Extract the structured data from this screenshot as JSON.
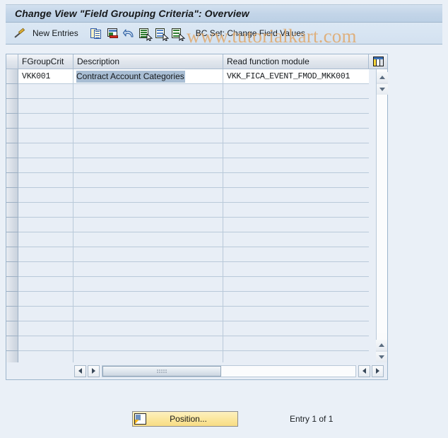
{
  "window": {
    "title": "Change View \"Field Grouping Criteria\": Overview"
  },
  "watermark": {
    "text": "www.tutorialkart.com",
    "color": "#e0a86a"
  },
  "toolbar": {
    "items": [
      {
        "name": "display-change-icon",
        "icon": "pencil-icon",
        "label": ""
      },
      {
        "name": "new-entries-button",
        "icon": "",
        "label": "New Entries"
      },
      {
        "name": "copy-as-button",
        "icon": "copy-icon",
        "label": ""
      },
      {
        "name": "delete-button",
        "icon": "delete-icon",
        "label": ""
      },
      {
        "name": "undo-button",
        "icon": "undo-icon",
        "label": ""
      },
      {
        "name": "select-all-button",
        "icon": "select-all-icon",
        "label": ""
      },
      {
        "name": "select-block-button",
        "icon": "select-block-icon",
        "label": ""
      },
      {
        "name": "deselect-all-button",
        "icon": "deselect-all-icon",
        "label": ""
      },
      {
        "name": "bc-set-button",
        "icon": "",
        "label": "BC Set: Change Field Values"
      }
    ],
    "new_entries_label": "New Entries",
    "bc_set_label": "BC Set: Change Field Values"
  },
  "table": {
    "columns": [
      {
        "key": "fgroupcrit",
        "label": "FGroupCrit"
      },
      {
        "key": "description",
        "label": "Description"
      },
      {
        "key": "read_function_module",
        "label": "Read function module"
      }
    ],
    "config_icon": "column-config-icon",
    "rows": [
      {
        "fgroupcrit": "VKK001",
        "description": "Contract Account Categories",
        "read_function_module": "VKK_FICA_EVENT_FMOD_MKK001",
        "description_selected": true
      }
    ],
    "empty_row_count": 19,
    "selection_highlight_color": "#a9bed4"
  },
  "scrollbars": {
    "vertical": {
      "up_arrow": "triangle-up-icon",
      "down_arrow": "triangle-down-icon"
    },
    "horizontal": {
      "left_arrow": "triangle-left-icon",
      "right_arrow": "triangle-right-icon",
      "thumb_grip": "grip-icon"
    }
  },
  "footer": {
    "position_button_label": "Position...",
    "position_button_icon": "position-icon",
    "entry_status": "Entry 1 of 1"
  }
}
